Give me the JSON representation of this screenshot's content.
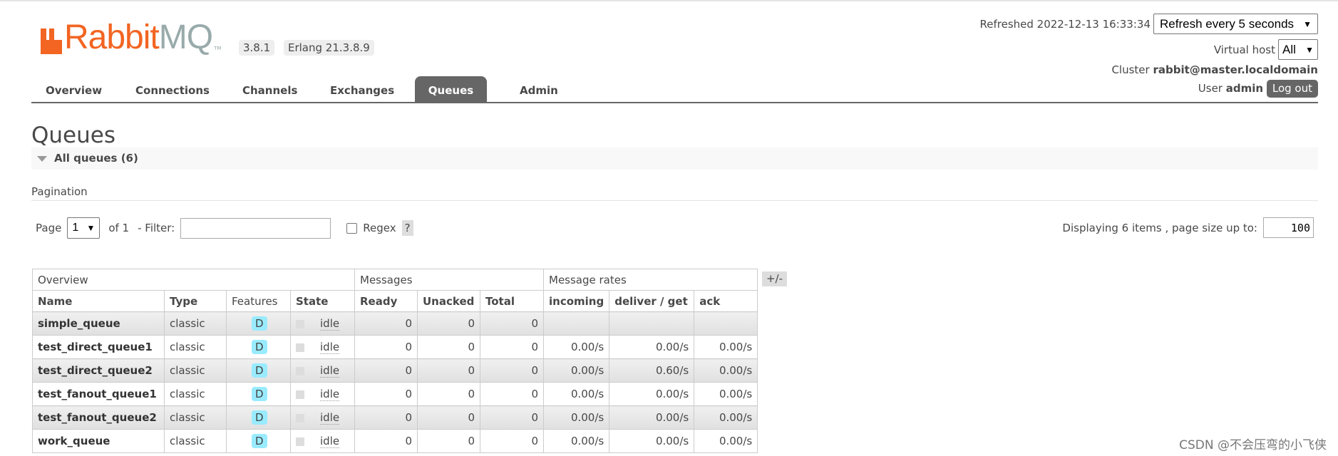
{
  "header": {
    "logo_text_orange": "Rabbit",
    "logo_text_gray": "MQ",
    "logo_tm": "TM",
    "version": "3.8.1",
    "erlang": "Erlang 21.3.8.9",
    "refreshed": "Refreshed 2022-12-13 16:33:34",
    "refresh_select": "Refresh every 5 seconds",
    "vhost_label": "Virtual host",
    "vhost_select": "All",
    "cluster_label": "Cluster",
    "cluster": "rabbit@master.localdomain",
    "user_label": "User",
    "user": "admin",
    "logout": "Log out"
  },
  "nav": {
    "tabs": [
      "Overview",
      "Connections",
      "Channels",
      "Exchanges",
      "Queues",
      "Admin"
    ],
    "active": "Queues"
  },
  "page": {
    "title": "Queues",
    "section": "All queues (6)"
  },
  "pagination": {
    "heading": "Pagination",
    "page_label": "Page",
    "page": "1",
    "of": "of 1",
    "filter_label": "- Filter:",
    "filter_value": "",
    "regex_label": "Regex",
    "help": "?",
    "regex_checked": false,
    "displaying": "Displaying 6 items , page size up to:",
    "page_size": "100"
  },
  "table": {
    "groups": [
      "Overview",
      "Messages",
      "Message rates"
    ],
    "columns": [
      "Name",
      "Type",
      "Features",
      "State",
      "Ready",
      "Unacked",
      "Total",
      "incoming",
      "deliver / get",
      "ack"
    ],
    "toggle": "+/-",
    "rows": [
      {
        "name": "simple_queue",
        "type": "classic",
        "feature": "D",
        "state": "idle",
        "ready": "0",
        "unacked": "0",
        "total": "0",
        "incoming": "",
        "deliver": "",
        "ack": ""
      },
      {
        "name": "test_direct_queue1",
        "type": "classic",
        "feature": "D",
        "state": "idle",
        "ready": "0",
        "unacked": "0",
        "total": "0",
        "incoming": "0.00/s",
        "deliver": "0.00/s",
        "ack": "0.00/s"
      },
      {
        "name": "test_direct_queue2",
        "type": "classic",
        "feature": "D",
        "state": "idle",
        "ready": "0",
        "unacked": "0",
        "total": "0",
        "incoming": "0.00/s",
        "deliver": "0.60/s",
        "ack": "0.00/s"
      },
      {
        "name": "test_fanout_queue1",
        "type": "classic",
        "feature": "D",
        "state": "idle",
        "ready": "0",
        "unacked": "0",
        "total": "0",
        "incoming": "0.00/s",
        "deliver": "0.00/s",
        "ack": "0.00/s"
      },
      {
        "name": "test_fanout_queue2",
        "type": "classic",
        "feature": "D",
        "state": "idle",
        "ready": "0",
        "unacked": "0",
        "total": "0",
        "incoming": "0.00/s",
        "deliver": "0.00/s",
        "ack": "0.00/s"
      },
      {
        "name": "work_queue",
        "type": "classic",
        "feature": "D",
        "state": "idle",
        "ready": "0",
        "unacked": "0",
        "total": "0",
        "incoming": "0.00/s",
        "deliver": "0.00/s",
        "ack": "0.00/s"
      }
    ]
  },
  "watermark": "CSDN @不会压弯的小飞侠",
  "colors": {
    "brand": "#f26522",
    "active_tab": "#666666",
    "feature_badge": "#99ebff"
  }
}
